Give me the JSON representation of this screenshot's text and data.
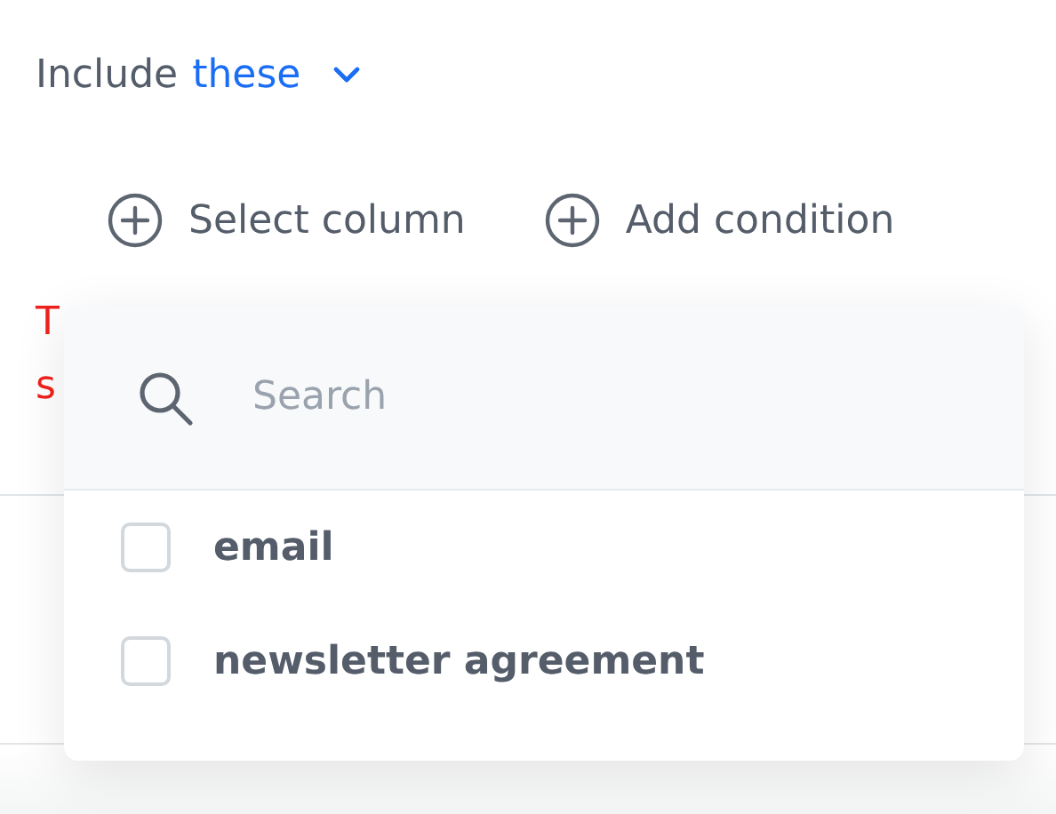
{
  "filter": {
    "label": "Include",
    "mode": "these"
  },
  "actions": [
    {
      "label": "Select column"
    },
    {
      "label": "Add condition"
    }
  ],
  "error_lines": [
    "T",
    "s"
  ],
  "dropdown": {
    "search": {
      "placeholder": "Search"
    },
    "options": [
      {
        "label": "email",
        "checked": false
      },
      {
        "label": "newsletter agreement",
        "checked": false
      }
    ]
  }
}
